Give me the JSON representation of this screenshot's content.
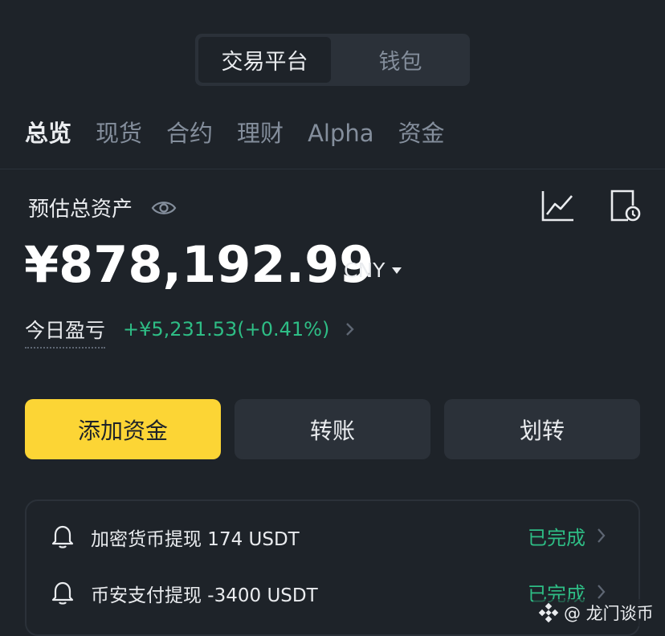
{
  "toggle": {
    "active": "交易平台",
    "inactive": "钱包"
  },
  "tabs": [
    "总览",
    "现货",
    "合约",
    "理财",
    "Alpha",
    "资金"
  ],
  "summary": {
    "label": "预估总资产",
    "balance": "¥878,192.99",
    "currency": "CNY",
    "pnl_label": "今日盈亏",
    "pnl_value": "+¥5,231.53(+0.41%)"
  },
  "actions": {
    "add_funds": "添加资金",
    "transfer": "转账",
    "move": "划转"
  },
  "notifications": [
    {
      "text": "加密货币提现 174 USDT",
      "status": "已完成"
    },
    {
      "text": "币安支付提现 -3400 USDT",
      "status": "已完成"
    }
  ],
  "watermark": {
    "text": "@ 龙门谈币"
  },
  "colors": {
    "background": "#1e2329",
    "surface": "#2b3139",
    "accent_yellow": "#fcd535",
    "success_green": "#2ebd85",
    "muted": "#848e9c"
  },
  "icons": [
    "eye-icon",
    "chart-icon",
    "history-icon",
    "caret-down-icon",
    "chevron-right-icon",
    "bell-icon",
    "binance-logo-icon"
  ]
}
